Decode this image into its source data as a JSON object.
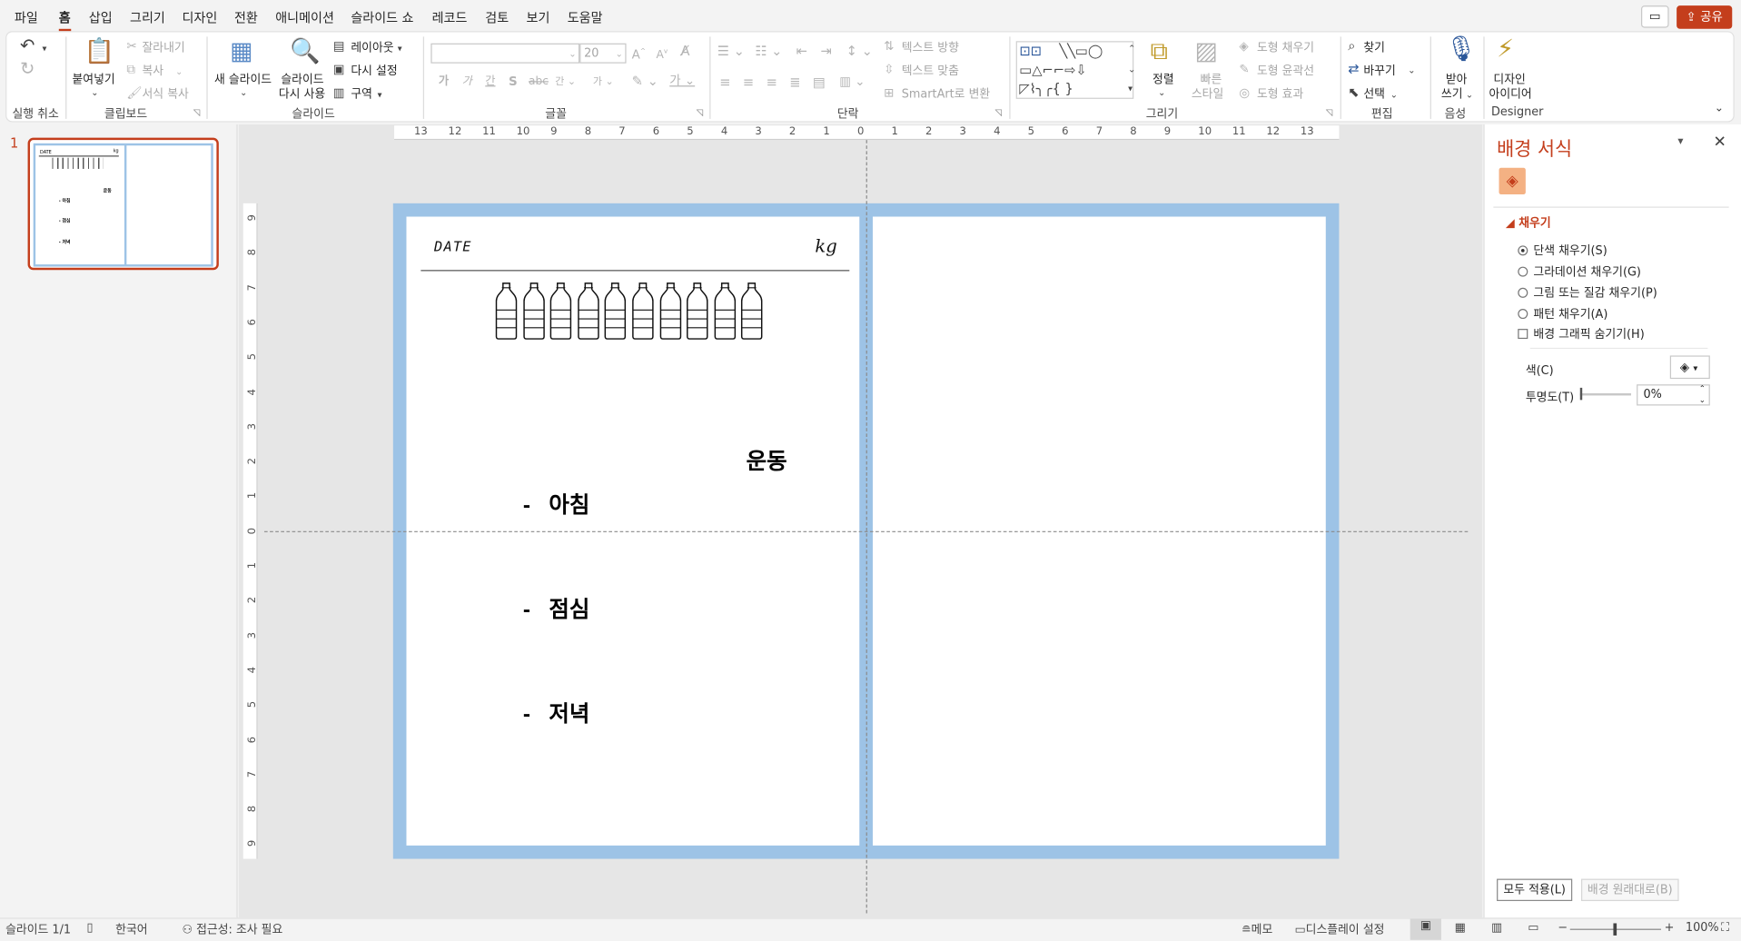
{
  "menu": {
    "items": [
      "파일",
      "홈",
      "삽입",
      "그리기",
      "디자인",
      "전환",
      "애니메이션",
      "슬라이드 쇼",
      "레코드",
      "검토",
      "보기",
      "도움말"
    ],
    "share_label": "공유"
  },
  "ribbon": {
    "groups": {
      "undo": "실행 취소",
      "clipboard": "클립보드",
      "slides": "슬라이드",
      "font": "글꼴",
      "paragraph": "단락",
      "drawing": "그리기",
      "editing": "편집",
      "voice": "음성",
      "designer": "Designer"
    },
    "clipboard": {
      "paste": "붙여넣기",
      "cut": "잘라내기",
      "copy": "복사",
      "format_painter": "서식 복사"
    },
    "slides": {
      "new_slide": "새 슬라이드",
      "reuse_line1": "슬라이드",
      "reuse_line2": "다시 사용",
      "layout": "레이아웃",
      "reset": "다시 설정",
      "section": "구역"
    },
    "font": {
      "size": "20"
    },
    "paragraph": {
      "text_direction": "텍스트 방향",
      "align_text": "텍스트 맞춤",
      "smartart": "SmartArt로 변환"
    },
    "drawing": {
      "arrange": "정렬",
      "quick_styles_line1": "빠른",
      "quick_styles_line2": "스타일",
      "shape_fill": "도형 채우기",
      "shape_outline": "도형 윤곽선",
      "shape_effects": "도형 효과"
    },
    "editing": {
      "find": "찾기",
      "replace": "바꾸기",
      "select": "선택"
    },
    "voice": {
      "dictate_line1": "받아",
      "dictate_line2": "쓰기"
    },
    "designer": {
      "ideas_line1": "디자인",
      "ideas_line2": "아이디어"
    }
  },
  "thumbnails": {
    "slide_number": "1"
  },
  "slide": {
    "date_label": "DATE",
    "unit_label": "kg",
    "bottle_count": 10,
    "exercise_label": "운동",
    "meals": [
      {
        "dash": "-",
        "label": "아침"
      },
      {
        "dash": "-",
        "label": "점심"
      },
      {
        "dash": "-",
        "label": "저녁"
      }
    ],
    "border_color": "#9dc3e6"
  },
  "format_pane": {
    "title": "배경 서식",
    "section": "채우기",
    "options": [
      {
        "label": "단색 채우기(S)",
        "selected": true
      },
      {
        "label": "그라데이션 채우기(G)",
        "selected": false
      },
      {
        "label": "그림 또는 질감 채우기(P)",
        "selected": false
      },
      {
        "label": "패턴 채우기(A)",
        "selected": false
      }
    ],
    "hide_graphics": "배경 그래픽 숨기기(H)",
    "color_label": "색(C)",
    "transparency_label": "투명도(T)",
    "transparency_value": "0%",
    "apply_all": "모두 적용(L)",
    "reset_background": "배경 원래대로(B)",
    "accent_color": "#c43e1c"
  },
  "status": {
    "slide_info": "슬라이드 1/1",
    "language": "한국어",
    "accessibility": "접근성: 조사 필요",
    "notes": "메모",
    "display_settings": "디스플레이 설정",
    "zoom": "100%"
  },
  "rulers": {
    "horizontal": [
      "13",
      "12",
      "11",
      "10",
      "9",
      "8",
      "7",
      "6",
      "5",
      "4",
      "3",
      "2",
      "1",
      "0",
      "1",
      "2",
      "3",
      "4",
      "5",
      "6",
      "7",
      "8",
      "9",
      "10",
      "11",
      "12",
      "13"
    ],
    "vertical": [
      "9",
      "8",
      "7",
      "6",
      "5",
      "4",
      "3",
      "2",
      "1",
      "0",
      "1",
      "2",
      "3",
      "4",
      "5",
      "6",
      "7",
      "8",
      "9"
    ]
  }
}
